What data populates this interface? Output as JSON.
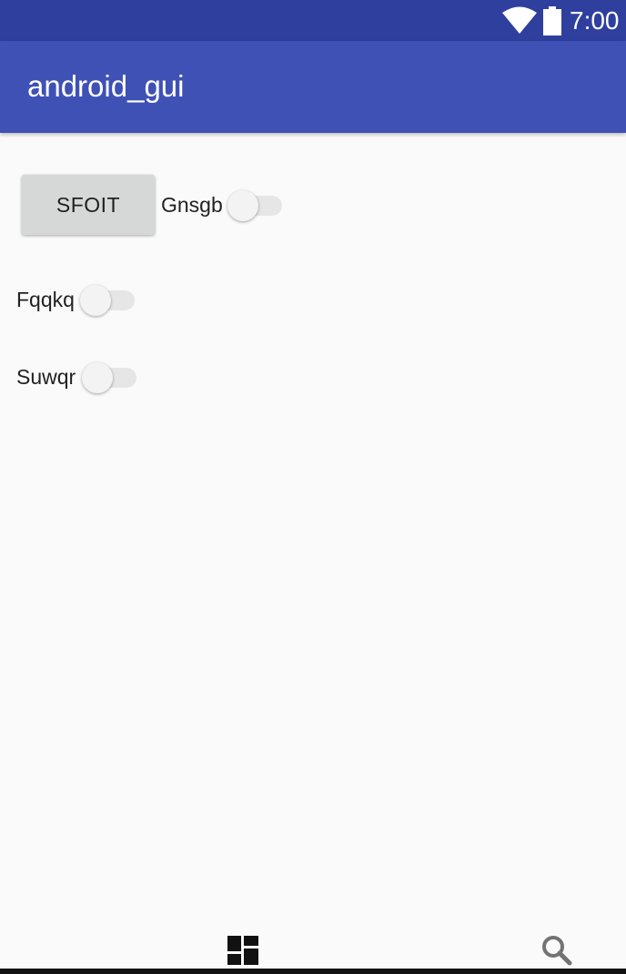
{
  "status_bar": {
    "time": "7:00",
    "icons": [
      "wifi-icon",
      "battery-icon"
    ]
  },
  "app_bar": {
    "title": "android_gui"
  },
  "content": {
    "button_label": "SFOIT",
    "switches": [
      {
        "label": "Gnsgb",
        "checked": false
      },
      {
        "label": "Fqqkq",
        "checked": false
      },
      {
        "label": "Suwqr",
        "checked": false
      }
    ]
  },
  "bottom_bar": {
    "icons": [
      "dashboard-icon",
      "search-icon"
    ]
  },
  "colors": {
    "status_bar": "#2f3f9e",
    "app_bar": "#3f51b5",
    "background": "#fafafa",
    "button": "#d6d7d7"
  }
}
